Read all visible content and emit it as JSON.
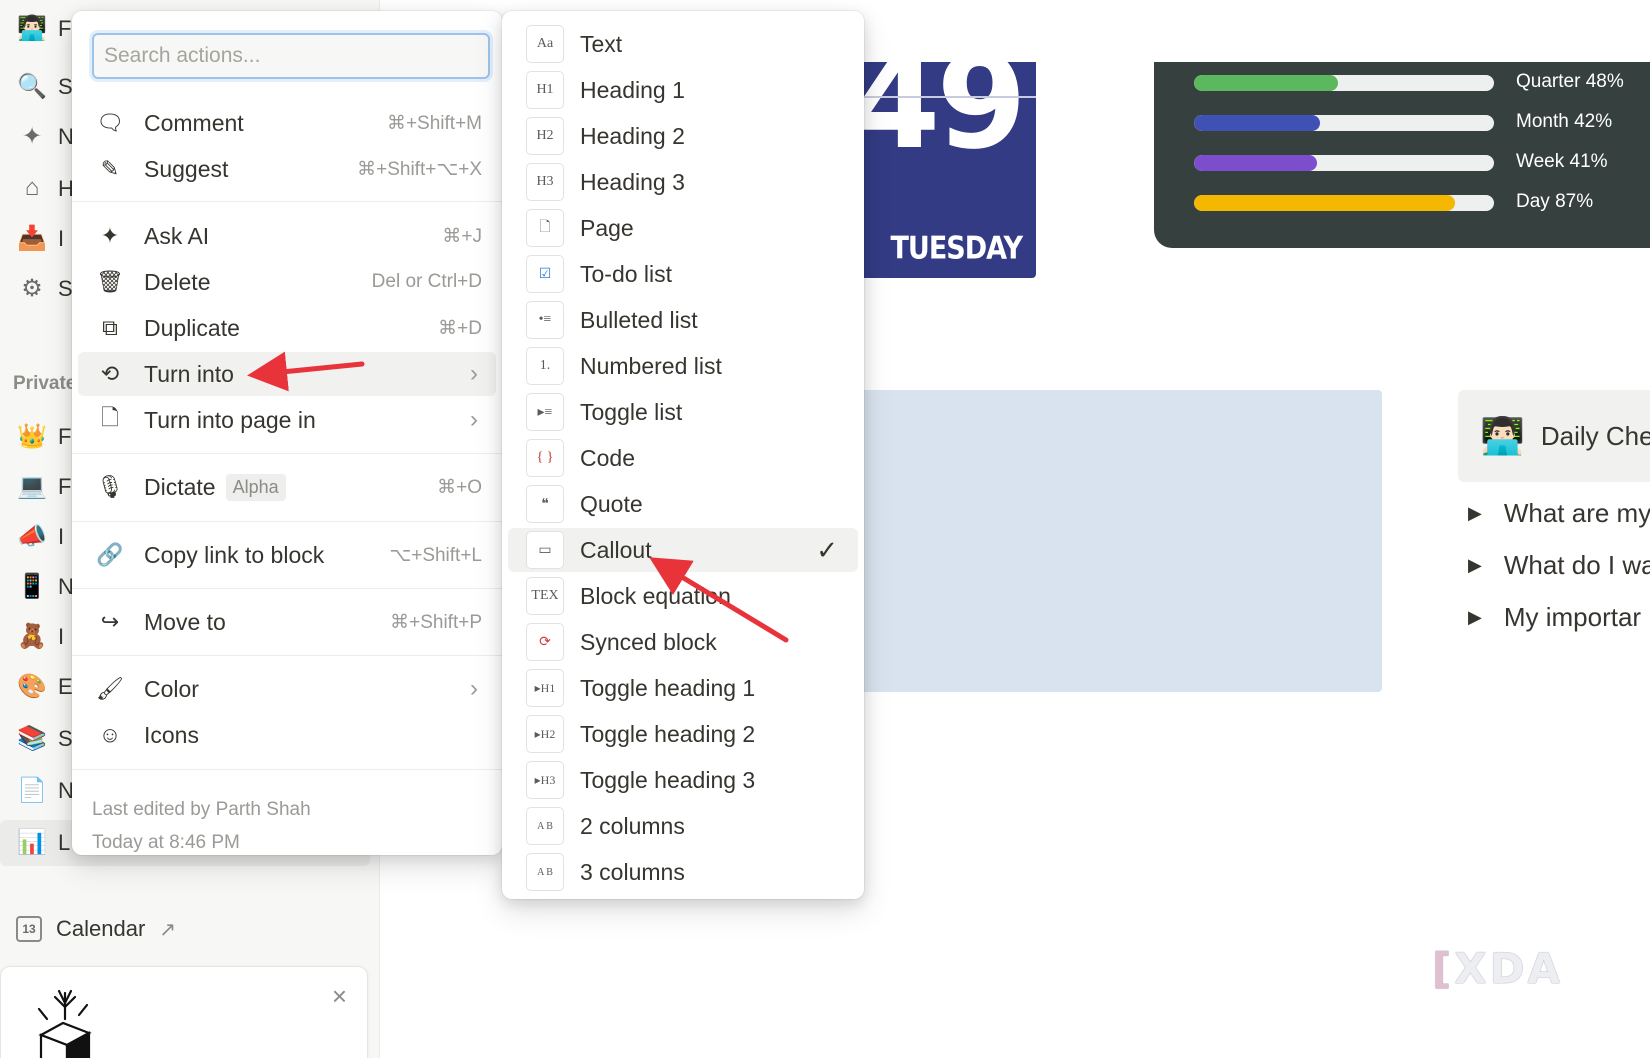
{
  "sidebar": {
    "items": [
      {
        "icon": "avatar-icon",
        "glyph": "👨🏻‍💻",
        "label": "F"
      },
      {
        "icon": "search-icon",
        "glyph": "🔍",
        "label": "S"
      },
      {
        "icon": "sparkle-icon",
        "glyph": "✦",
        "label": "N"
      },
      {
        "icon": "home-icon",
        "glyph": "⌂",
        "label": "H"
      },
      {
        "icon": "inbox-icon",
        "glyph": "📥",
        "label": "I"
      },
      {
        "icon": "settings-icon",
        "glyph": "⚙",
        "label": "S"
      }
    ],
    "private_label": "Private",
    "private_items": [
      {
        "icon": "crown-icon",
        "glyph": "👑",
        "label": "F"
      },
      {
        "icon": "laptop-icon",
        "glyph": "💻",
        "label": "F"
      },
      {
        "icon": "megaphone-icon",
        "glyph": "📣",
        "label": "I"
      },
      {
        "icon": "phone-icon",
        "glyph": "📱",
        "label": "N"
      },
      {
        "icon": "bear-icon",
        "glyph": "🧸",
        "label": "I"
      },
      {
        "icon": "palette-icon",
        "glyph": "🎨",
        "label": "E"
      },
      {
        "icon": "books-icon",
        "glyph": "📚",
        "label": "S"
      },
      {
        "icon": "page-icon",
        "glyph": "📄",
        "label": "N"
      },
      {
        "icon": "chart-icon",
        "glyph": "📊",
        "label": "L"
      }
    ],
    "calendar": {
      "label": "Calendar",
      "icon_text": "13",
      "ext": "↗"
    },
    "card_close": "×"
  },
  "page": {
    "date_number": "49",
    "date_day": "TUESDAY",
    "progress": [
      {
        "label": "Quarter 48%",
        "value": 48,
        "color": "#5cb85c"
      },
      {
        "label": "Month 42%",
        "value": 42,
        "color": "#3f51b5"
      },
      {
        "label": "Week 41%",
        "value": 41,
        "color": "#7c4dcc"
      },
      {
        "label": "Day 87%",
        "value": 87,
        "color": "#f5b800"
      }
    ],
    "daily_title": "Daily Chec",
    "questions": [
      "What are my",
      "What do I wa",
      "My importar"
    ],
    "watermark": "XDA"
  },
  "action_menu": {
    "search_placeholder": "Search actions...",
    "items": [
      {
        "name": "comment",
        "icon": "comment-icon",
        "glyph": "🗨",
        "label": "Comment",
        "shortcut": "⌘+Shift+M"
      },
      {
        "name": "suggest",
        "icon": "suggest-icon",
        "glyph": "✎",
        "label": "Suggest",
        "shortcut": "⌘+Shift+⌥+X"
      },
      {
        "name": "ask-ai",
        "icon": "sparkle-icon",
        "glyph": "✦",
        "label": "Ask AI",
        "shortcut": "⌘+J"
      },
      {
        "name": "delete",
        "icon": "trash-icon",
        "glyph": "🗑",
        "label": "Delete",
        "shortcut": "Del or Ctrl+D"
      },
      {
        "name": "duplicate",
        "icon": "duplicate-icon",
        "glyph": "⧉",
        "label": "Duplicate",
        "shortcut": "⌘+D"
      },
      {
        "name": "turn-into",
        "icon": "turn-into-icon",
        "glyph": "⟲",
        "label": "Turn into",
        "chevron": "›"
      },
      {
        "name": "turn-into-page-in",
        "icon": "page-icon",
        "glyph": "🗋",
        "label": "Turn into page in",
        "chevron": "›"
      },
      {
        "name": "dictate",
        "icon": "microphone-icon",
        "glyph": "🎙",
        "label": "Dictate",
        "badge": "Alpha",
        "shortcut": "⌘+O"
      },
      {
        "name": "copy-link",
        "icon": "link-icon",
        "glyph": "🔗",
        "label": "Copy link to block",
        "shortcut": "⌥+Shift+L"
      },
      {
        "name": "move-to",
        "icon": "move-icon",
        "glyph": "↪",
        "label": "Move to",
        "shortcut": "⌘+Shift+P"
      },
      {
        "name": "color",
        "icon": "paint-roller-icon",
        "glyph": "🖌",
        "label": "Color",
        "chevron": "›"
      },
      {
        "name": "icons",
        "icon": "smiley-icon",
        "glyph": "☺",
        "label": "Icons"
      }
    ],
    "last_edited_by": "Last edited by Parth Shah",
    "last_edited_time": "Today at 8:46 PM"
  },
  "turn_into_menu": {
    "items": [
      {
        "name": "text",
        "icon": "text-icon",
        "glyph": "Aa",
        "label": "Text"
      },
      {
        "name": "heading-1",
        "icon": "heading-1-icon",
        "glyph": "H1",
        "label": "Heading 1"
      },
      {
        "name": "heading-2",
        "icon": "heading-2-icon",
        "glyph": "H2",
        "label": "Heading 2"
      },
      {
        "name": "heading-3",
        "icon": "heading-3-icon",
        "glyph": "H3",
        "label": "Heading 3"
      },
      {
        "name": "page",
        "icon": "page-icon",
        "glyph": "🗋",
        "label": "Page"
      },
      {
        "name": "todo-list",
        "icon": "checkbox-icon",
        "glyph": "☑",
        "label": "To-do list"
      },
      {
        "name": "bulleted-list",
        "icon": "bullet-icon",
        "glyph": "•≡",
        "label": "Bulleted list"
      },
      {
        "name": "numbered-list",
        "icon": "numbered-icon",
        "glyph": "1.",
        "label": "Numbered list"
      },
      {
        "name": "toggle-list",
        "icon": "toggle-icon",
        "glyph": "▸≡",
        "label": "Toggle list"
      },
      {
        "name": "code",
        "icon": "code-icon",
        "glyph": "{ }",
        "label": "Code"
      },
      {
        "name": "quote",
        "icon": "quote-icon",
        "glyph": "❝",
        "label": "Quote"
      },
      {
        "name": "callout",
        "icon": "callout-icon",
        "glyph": "▭",
        "label": "Callout",
        "checked": "✓"
      },
      {
        "name": "block-equation",
        "icon": "tex-icon",
        "glyph": "TEX",
        "label": "Block equation"
      },
      {
        "name": "synced-block",
        "icon": "synced-icon",
        "glyph": "⟳",
        "label": "Synced block"
      },
      {
        "name": "toggle-heading-1",
        "icon": "toggle-h1-icon",
        "glyph": "▸H1",
        "label": "Toggle heading 1"
      },
      {
        "name": "toggle-heading-2",
        "icon": "toggle-h2-icon",
        "glyph": "▸H2",
        "label": "Toggle heading 2"
      },
      {
        "name": "toggle-heading-3",
        "icon": "toggle-h3-icon",
        "glyph": "▸H3",
        "label": "Toggle heading 3"
      },
      {
        "name": "2-columns",
        "icon": "columns-2-icon",
        "glyph": "A B",
        "label": "2 columns"
      },
      {
        "name": "3-columns",
        "icon": "columns-3-icon",
        "glyph": "A B",
        "label": "3 columns"
      }
    ]
  }
}
